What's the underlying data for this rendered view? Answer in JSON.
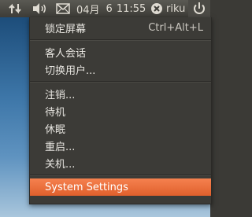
{
  "panel": {
    "date": "04月",
    "day": "6",
    "time": "11:55",
    "user": "riku"
  },
  "icons": {
    "network": "network-transfer-icon",
    "volume": "volume-icon",
    "mail": "mail-icon",
    "empathy": "messaging-icon",
    "power": "power-gear-icon"
  },
  "menu": {
    "lock": "锁定屏幕",
    "lock_shortcut": "Ctrl+Alt+L",
    "guest": "客人会话",
    "switch_user": "切换用户...",
    "logout": "注销...",
    "suspend": "待机",
    "hibernate": "休眠",
    "restart": "重启...",
    "shutdown": "关机...",
    "system_settings": "System Settings"
  },
  "colors": {
    "panel": "#3d3c37",
    "menu": "#3c3b37",
    "highlight": "#e8622c"
  }
}
